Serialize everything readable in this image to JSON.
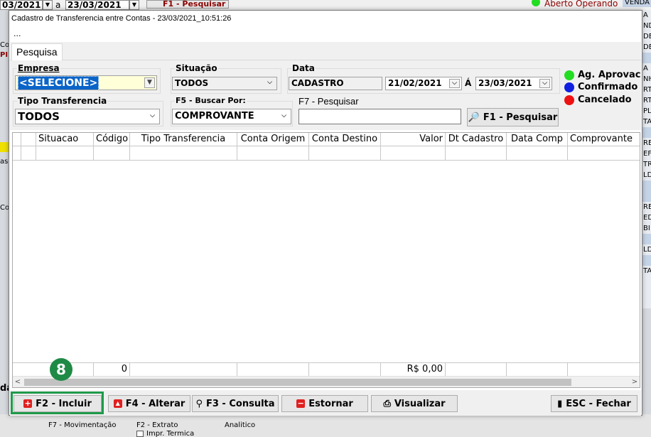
{
  "background": {
    "date_from": "03/2021",
    "date_sep": "a",
    "date_to": "23/03/2021",
    "search_button": "F1 - Pesquisar",
    "status_text": "Aberto Operando",
    "vendas_label": "VENDA",
    "right_fragments": [
      "A",
      "ND",
      "DE",
      "DE",
      "",
      "A",
      "NH",
      "RT",
      "RT",
      "PL",
      "TA",
      "",
      "RE",
      "EF",
      "TR",
      "LD",
      "",
      "",
      "RE",
      "ED",
      "BI",
      "",
      "LD",
      "",
      "TA"
    ],
    "left_fragments": [
      "Co",
      "PI",
      "as",
      "Co",
      "da"
    ],
    "bottom": {
      "movimentacao": "F7 - Movimentação",
      "extrato": "F2 - Extrato",
      "analitico": "Analitico",
      "impr": "Impr. Termica"
    }
  },
  "dialog": {
    "title": "Cadastro de Transferencia entre Contas - 23/03/2021_10:51:26",
    "subtitle": "...",
    "tab": "Pesquisa"
  },
  "filters": {
    "empresa": {
      "label": "Empresa",
      "value": "<SELECIONE>"
    },
    "situacao": {
      "label": "Situação",
      "value": "TODOS"
    },
    "data": {
      "label": "Data",
      "type_value": "CADASTRO",
      "from": "21/02/2021",
      "sep": "Á",
      "to": "23/03/2021"
    },
    "tipo": {
      "label": "Tipo Transferencia",
      "value": "TODOS"
    },
    "buscar": {
      "label": "F5 - Buscar Por:",
      "value": "COMPROVANTE"
    },
    "pesquisar": {
      "label": "F7 - Pesquisar",
      "value": ""
    },
    "search_button": "F1 - Pesquisar"
  },
  "legend": [
    {
      "label": "Ag. Aprovac",
      "color": "#22dd22"
    },
    {
      "label": "Confirmado",
      "color": "#1020e0"
    },
    {
      "label": "Cancelado",
      "color": "#ee1111"
    }
  ],
  "grid": {
    "columns": [
      "",
      "",
      "Situacao",
      "Código",
      "Tipo Transferencia",
      "Conta Origem",
      "Conta Destino",
      "Valor",
      "Dt Cadastro",
      "Data Comp",
      "Comprovante"
    ],
    "footer": {
      "codigo_count": "0",
      "valor_total": "R$ 0,00"
    }
  },
  "buttons": {
    "incluir": "F2 - Incluir",
    "alterar": "F4 - Alterar",
    "consulta": "F3 - Consulta",
    "estornar": "Estornar",
    "visualizar": "Visualizar",
    "fechar": "ESC - Fechar"
  },
  "annotation": {
    "badge": "8"
  },
  "colors": {
    "highlight": "#1f9a4a",
    "selection": "#0a64c8"
  }
}
